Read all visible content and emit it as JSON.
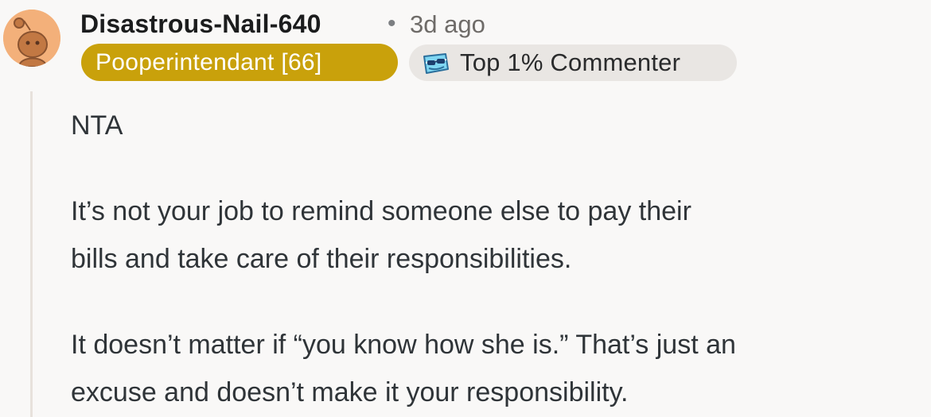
{
  "comment": {
    "author": "Disastrous-Nail-640",
    "separator": "•",
    "time": "3d ago",
    "flair": "Pooperintendant [66]",
    "badge": {
      "icon": "snoo-sunglasses-icon",
      "label": "Top 1% Commenter"
    },
    "body": {
      "line1": "NTA",
      "line2a": "It’s not your job to remind someone else to pay their",
      "line2b": "bills and take care of their responsibilities.",
      "line3a": "It doesn’t matter if “you know how she is.” That’s just an",
      "line3b": "excuse and doesn’t make it your responsibility."
    }
  },
  "colors": {
    "background": "#f9f8f7",
    "flair": "#c9a10b",
    "badge": "#e9e6e3",
    "avatar": "#f3b07a",
    "thread_line": "#e7e1dc"
  }
}
